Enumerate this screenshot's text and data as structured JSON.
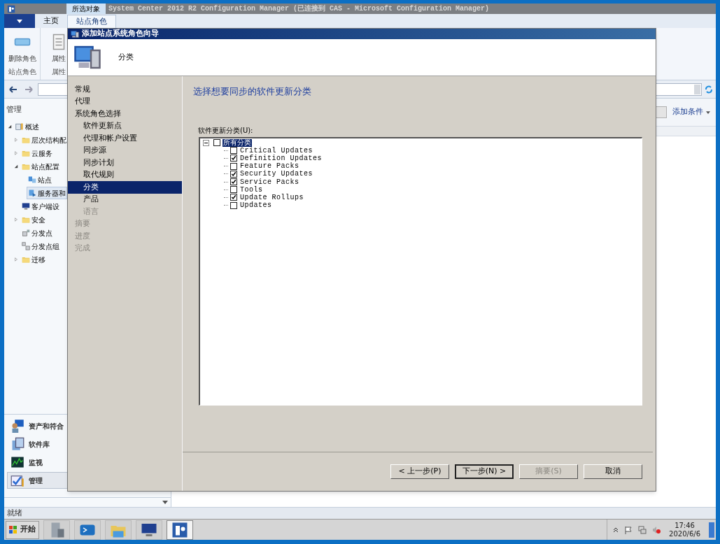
{
  "window": {
    "context_tab": "所选对象",
    "title": "System Center 2012 R2 Configuration Manager (已连接到 CAS - Microsoft Configuration Manager)"
  },
  "ribbon_tabs": [
    {
      "label": "主页",
      "selected": false
    },
    {
      "label": "站点角色",
      "selected": true
    }
  ],
  "ribbon": {
    "buttons": [
      {
        "label": "删除角色",
        "kind": "delete"
      },
      {
        "label": "属性",
        "kind": "properties"
      }
    ],
    "groups": [
      "站点角色",
      "属性"
    ]
  },
  "nav_pane": {
    "title": "管理",
    "tree": [
      {
        "label": "概述",
        "kind": "overview",
        "expanded": true,
        "selected": false,
        "children": [
          {
            "label": "层次结构配",
            "kind": "folder",
            "expanded": false,
            "selected": false
          },
          {
            "label": "云服务",
            "kind": "folder",
            "expanded": false,
            "selected": false
          },
          {
            "label": "站点配置",
            "kind": "folder",
            "expanded": true,
            "selected": false,
            "children": [
              {
                "label": "站点",
                "kind": "sites",
                "selected": false
              },
              {
                "label": "服务器和",
                "kind": "server",
                "selected": true
              }
            ]
          },
          {
            "label": "客户端设",
            "kind": "monitor",
            "selected": false
          },
          {
            "label": "安全",
            "kind": "folder",
            "expanded": false,
            "selected": false
          },
          {
            "label": "分发点",
            "kind": "dp",
            "selected": false
          },
          {
            "label": "分发点组",
            "kind": "dpgroup",
            "selected": false
          },
          {
            "label": "迁移",
            "kind": "folder",
            "expanded": false,
            "selected": false
          }
        ]
      }
    ],
    "workspaces": [
      {
        "label": "资产和符合",
        "kind": "assets",
        "selected": false
      },
      {
        "label": "软件库",
        "kind": "library",
        "selected": false
      },
      {
        "label": "监视",
        "kind": "monitoring",
        "selected": false
      },
      {
        "label": "管理",
        "kind": "admin",
        "selected": true
      }
    ]
  },
  "search_bar": {
    "add_criteria": "添加条件"
  },
  "status_bar": "就绪",
  "taskbar": {
    "start": "开始",
    "apps": [
      {
        "kind": "server-manager",
        "selected": false
      },
      {
        "kind": "powershell",
        "selected": false
      },
      {
        "kind": "explorer",
        "selected": false
      },
      {
        "kind": "monitor",
        "selected": false
      },
      {
        "kind": "configmgr",
        "selected": true
      }
    ],
    "time": "17:46",
    "date": "2020/6/6"
  },
  "wizard": {
    "title": "添加站点系统角色向导",
    "header": "分类",
    "steps": [
      {
        "label": "常规",
        "selected": false,
        "disabled": false
      },
      {
        "label": "代理",
        "selected": false,
        "disabled": false
      },
      {
        "label": "系统角色选择",
        "selected": false,
        "disabled": false,
        "children": [
          {
            "label": "软件更新点",
            "selected": false,
            "disabled": false
          },
          {
            "label": "代理和帐户设置",
            "selected": false,
            "disabled": false
          },
          {
            "label": "同步源",
            "selected": false,
            "disabled": false
          },
          {
            "label": "同步计划",
            "selected": false,
            "disabled": false
          },
          {
            "label": "取代规则",
            "selected": false,
            "disabled": false
          },
          {
            "label": "分类",
            "selected": true,
            "disabled": false
          },
          {
            "label": "产品",
            "selected": false,
            "disabled": false
          },
          {
            "label": "语言",
            "selected": false,
            "disabled": true
          }
        ]
      },
      {
        "label": "摘要",
        "selected": false,
        "disabled": true
      },
      {
        "label": "进度",
        "selected": false,
        "disabled": true
      },
      {
        "label": "完成",
        "selected": false,
        "disabled": true
      }
    ],
    "heading": "选择想要同步的软件更新分类",
    "list_label": "软件更新分类(U):",
    "classifications": [
      {
        "label": "所有分类",
        "checked": false,
        "selected": true,
        "expanded": true,
        "children": [
          {
            "label": "Critical Updates",
            "checked": false,
            "selected": false
          },
          {
            "label": "Definition Updates",
            "checked": true,
            "selected": false
          },
          {
            "label": "Feature Packs",
            "checked": false,
            "selected": false
          },
          {
            "label": "Security Updates",
            "checked": true,
            "selected": false
          },
          {
            "label": "Service Packs",
            "checked": true,
            "selected": false
          },
          {
            "label": "Tools",
            "checked": false,
            "selected": false
          },
          {
            "label": "Update Rollups",
            "checked": true,
            "selected": false
          },
          {
            "label": "Updates",
            "checked": false,
            "selected": false
          }
        ]
      }
    ],
    "buttons": [
      {
        "label": "< 上一步(P)",
        "disabled": false,
        "focused": false
      },
      {
        "label": "下一步(N) >",
        "disabled": false,
        "focused": true
      },
      {
        "label": "摘要(S)",
        "disabled": true,
        "focused": false
      },
      {
        "label": "取消",
        "disabled": false,
        "focused": false
      }
    ]
  }
}
